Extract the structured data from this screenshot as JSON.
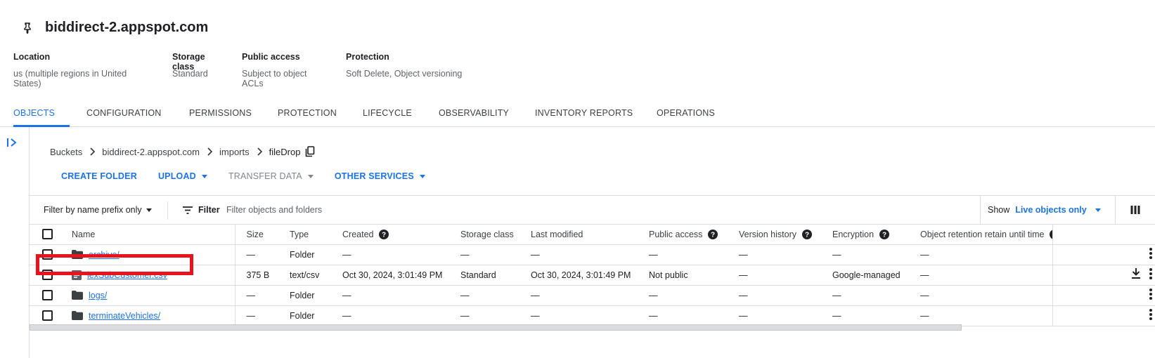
{
  "bucket": {
    "name": "biddirect-2.appspot.com"
  },
  "meta": [
    {
      "label": "Location",
      "value": "us (multiple regions in United States)"
    },
    {
      "label": "Storage class",
      "value": "Standard"
    },
    {
      "label": "Public access",
      "value": "Subject to object ACLs"
    },
    {
      "label": "Protection",
      "value": "Soft Delete, Object versioning"
    }
  ],
  "tabs": [
    {
      "label": "OBJECTS",
      "active": true
    },
    {
      "label": "CONFIGURATION"
    },
    {
      "label": "PERMISSIONS"
    },
    {
      "label": "PROTECTION"
    },
    {
      "label": "LIFECYCLE"
    },
    {
      "label": "OBSERVABILITY"
    },
    {
      "label": "INVENTORY REPORTS"
    },
    {
      "label": "OPERATIONS"
    }
  ],
  "breadcrumb": [
    "Buckets",
    "biddirect-2.appspot.com",
    "imports",
    "fileDrop"
  ],
  "actions": {
    "create_folder": "CREATE FOLDER",
    "upload": "UPLOAD",
    "transfer_data": "TRANSFER DATA",
    "other_services": "OTHER SERVICES"
  },
  "filter": {
    "prefix_mode": "Filter by name prefix only",
    "button": "Filter",
    "placeholder": "Filter objects and folders",
    "show_label": "Show",
    "show_value": "Live objects only"
  },
  "columns": [
    "Name",
    "Size",
    "Type",
    "Created",
    "Storage class",
    "Last modified",
    "Public access",
    "Version history",
    "Encryption",
    "Object retention retain until time"
  ],
  "rows": [
    {
      "kind": "folder",
      "name": "archive/",
      "size": "—",
      "type": "Folder",
      "created": "—",
      "storage_class": "—",
      "last_modified": "—",
      "public_access": "—",
      "version_history": "—",
      "encryption": "—",
      "retention": "—"
    },
    {
      "kind": "file",
      "name": "lexSubCustomer.csv",
      "size": "375 B",
      "type": "text/csv",
      "created": "Oct 30, 2024, 3:01:49 PM",
      "storage_class": "Standard",
      "last_modified": "Oct 30, 2024, 3:01:49 PM",
      "public_access": "Not public",
      "version_history": "—",
      "encryption": "Google-managed",
      "retention": "—"
    },
    {
      "kind": "folder",
      "name": "logs/",
      "size": "—",
      "type": "Folder",
      "created": "—",
      "storage_class": "—",
      "last_modified": "—",
      "public_access": "—",
      "version_history": "—",
      "encryption": "—",
      "retention": "—"
    },
    {
      "kind": "folder",
      "name": "terminateVehicles/",
      "size": "—",
      "type": "Folder",
      "created": "—",
      "storage_class": "—",
      "last_modified": "—",
      "public_access": "—",
      "version_history": "—",
      "encryption": "—",
      "retention": "—"
    }
  ],
  "colors": {
    "accent": "#1a73e8",
    "highlight": "#e8131d",
    "text": "#202124"
  }
}
